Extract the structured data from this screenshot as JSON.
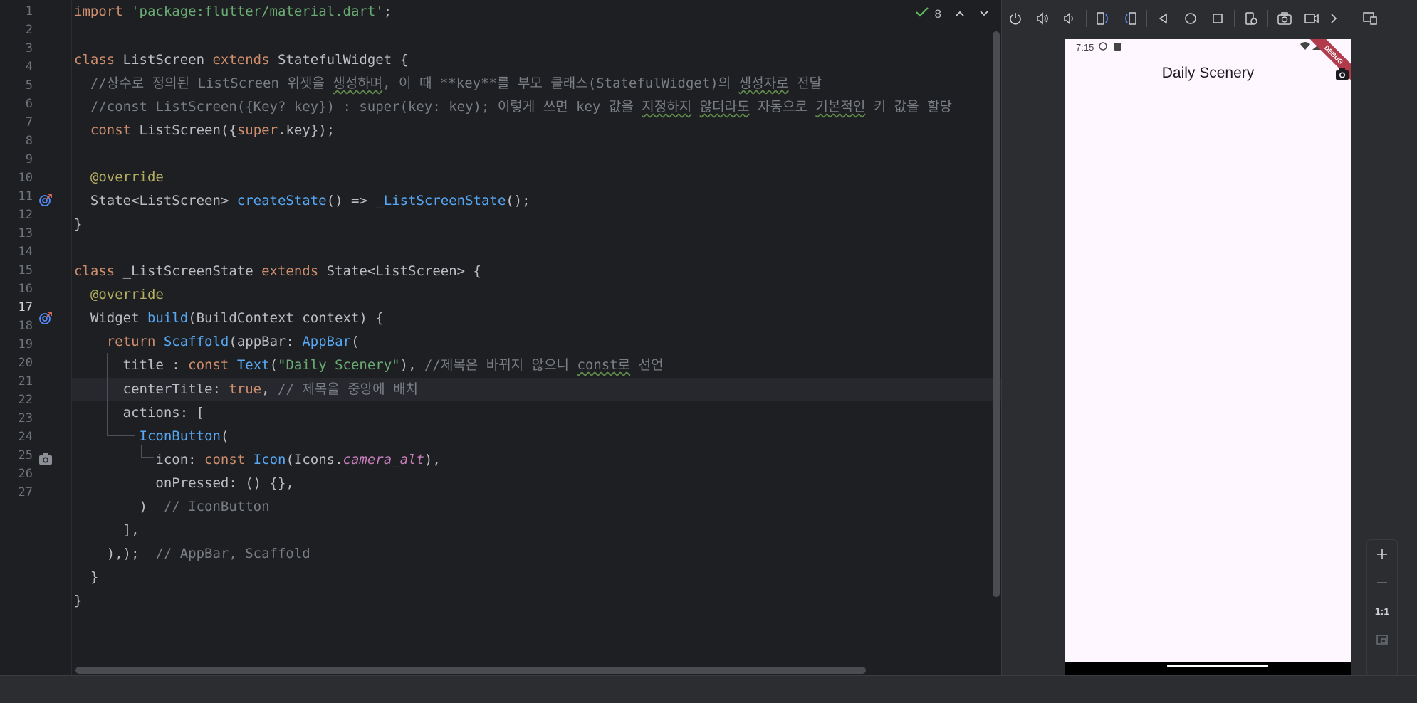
{
  "editor": {
    "inspection": {
      "count": "8"
    },
    "current_line": 17,
    "lines": [
      {
        "num": "1"
      },
      {
        "num": "2"
      },
      {
        "num": "3"
      },
      {
        "num": "4"
      },
      {
        "num": "5"
      },
      {
        "num": "6"
      },
      {
        "num": "7"
      },
      {
        "num": "8"
      },
      {
        "num": "9"
      },
      {
        "num": "10"
      },
      {
        "num": "11"
      },
      {
        "num": "12"
      },
      {
        "num": "13"
      },
      {
        "num": "14"
      },
      {
        "num": "15"
      },
      {
        "num": "16"
      },
      {
        "num": "17"
      },
      {
        "num": "18"
      },
      {
        "num": "19"
      },
      {
        "num": "20"
      },
      {
        "num": "21"
      },
      {
        "num": "22"
      },
      {
        "num": "23"
      },
      {
        "num": "24"
      },
      {
        "num": "25"
      },
      {
        "num": "26"
      },
      {
        "num": "27"
      }
    ],
    "code": {
      "l1_kw": "import",
      "l1_str": "'package:flutter/material.dart'",
      "l1_end": ";",
      "l3_kw1": "class",
      "l3_name": " ListScreen ",
      "l3_kw2": "extends",
      "l3_rest": " StatefulWidget {",
      "l4_a": "  //상수로 정의된 ListScreen 위젯을 ",
      "l4_b": "생성하며",
      "l4_c": ", 이 때 **key**를 부모 클래스(StatefulWidget)의 ",
      "l4_d": "생성자로",
      "l4_e": " 전달",
      "l5_a": "  //const ListScreen({Key? key}) : super(key: key); 이렇게 쓰면 key 값을 ",
      "l5_b": "지정하지",
      "l5_c": " ",
      "l5_d": "않더라도",
      "l5_e": " 자동으로 ",
      "l5_f": "기본적인",
      "l5_g": " 키 값을 할당",
      "l6_pre": "  ",
      "l6_kw": "const",
      "l6_mid": " ListScreen({",
      "l6_kw2": "super",
      "l6_end": ".key});",
      "l8": "  @override",
      "l9_pre": "  State<ListScreen> ",
      "l9_fn": "createState",
      "l9_mid": "() => ",
      "l9_fn2": "_ListScreenState",
      "l9_end": "();",
      "l10": "}",
      "l12_kw1": "class",
      "l12_name": " _ListScreenState ",
      "l12_kw2": "extends",
      "l12_rest": " State<ListScreen> {",
      "l13": "  @override",
      "l14_pre": "  Widget ",
      "l14_fn": "build",
      "l14_end": "(BuildContext context) {",
      "l15_pre": "    ",
      "l15_kw": "return",
      "l15_sp": " ",
      "l15_fn": "Scaffold",
      "l15_mid": "(appBar: ",
      "l15_fn2": "AppBar",
      "l15_end": "(",
      "l16_pre": "      title : ",
      "l16_kw": "const",
      "l16_sp": " ",
      "l16_fn": "Text",
      "l16_p": "(",
      "l16_str": "\"Daily Scenery\"",
      "l16_p2": "), ",
      "l16_cmt": "//제목은 바뀌지 않으니 ",
      "l16_cmt2": "const로",
      "l16_cmt3": " 선언",
      "l17_pre": "      centerTitle: ",
      "l17_kw": "true",
      "l17_p": ", ",
      "l17_cmt": "// 제목을 중앙에 배치",
      "l18": "      actions: [",
      "l19_pre": "        ",
      "l19_fn": "IconButton",
      "l19_end": "(",
      "l20_pre": "          icon: ",
      "l20_kw": "const",
      "l20_sp": " ",
      "l20_fn": "Icon",
      "l20_mid": "(Icons.",
      "l20_it": "camera_alt",
      "l20_end": "),",
      "l21": "          onPressed: () {},",
      "l22_pre": "        )  ",
      "l22_cmt": "// IconButton",
      "l23": "      ],",
      "l24_pre": "    ),);  ",
      "l24_cmt": "// AppBar, Scaffold",
      "l25": "  }",
      "l26": "}"
    }
  },
  "emulator": {
    "status_time": "7:15",
    "app_title": "Daily Scenery",
    "debug_label": "DEBUG",
    "zoom_ratio": "1:1"
  },
  "colors": {
    "keyword": "#cf8e6d",
    "string": "#6aab73",
    "comment": "#7a7e85",
    "function": "#56a8f5",
    "annotation": "#b3ae60",
    "italic_member": "#c77dbb"
  },
  "icons": [
    "check-icon",
    "chevron-up-icon",
    "chevron-down-icon",
    "override-icon",
    "camera-icon",
    "power-icon",
    "volume-up-icon",
    "volume-down-icon",
    "rotate-left-icon",
    "rotate-right-icon",
    "back-icon",
    "home-icon",
    "overview-icon",
    "settings-icon",
    "screenshot-icon",
    "record-icon",
    "more-icon",
    "device-mirror-icon",
    "plus-icon",
    "minus-icon",
    "fit-screen-icon"
  ]
}
